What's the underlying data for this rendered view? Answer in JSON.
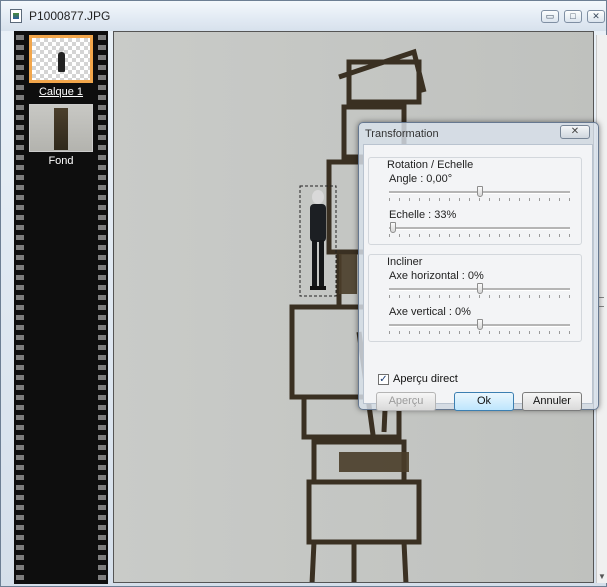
{
  "window": {
    "title": "P1000877.JPG"
  },
  "titlebar_buttons": {
    "minimize": "▭",
    "maximize": "□",
    "close": "✕"
  },
  "layers": [
    {
      "label": "Calque 1",
      "selected": true
    },
    {
      "label": "Fond",
      "selected": false
    }
  ],
  "dialog": {
    "title": "Transformation",
    "close": "✕",
    "rotation_group": {
      "title": "Rotation / Echelle",
      "angle": {
        "label": "Angle : 0,00°"
      },
      "scale": {
        "label": "Echelle : 33%"
      }
    },
    "incline_group": {
      "title": "Incliner",
      "horizontal": {
        "label": "Axe horizontal : 0%"
      },
      "vertical": {
        "label": "Axe vertical : 0%"
      }
    },
    "preview_checkbox": {
      "label": "Aperçu direct",
      "checked": true,
      "mark": "✓"
    },
    "buttons": {
      "apercu": "Aperçu",
      "ok": "Ok",
      "annuler": "Annuler"
    }
  },
  "colors": {
    "selection_accent": "#f2a64b",
    "default_button": "#3c7fb1"
  }
}
